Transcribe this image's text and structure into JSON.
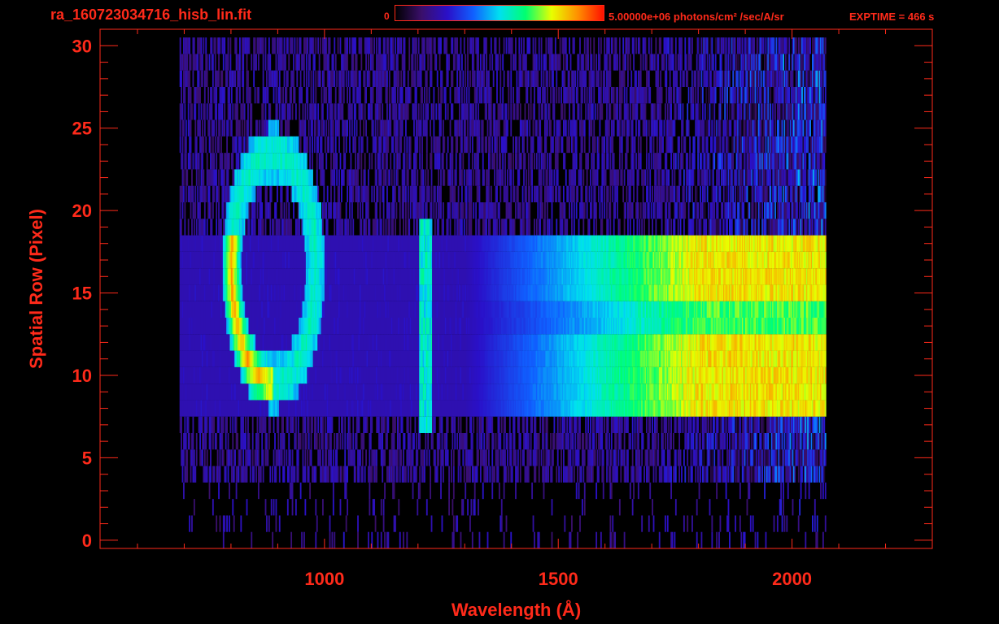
{
  "header": {
    "filename": "ra_160723034716_hisb_lin.fit",
    "colorbar_min": "0",
    "colorbar_max_label": "5.00000e+06 photons/cm² /sec/A/sr",
    "exptime": "EXPTIME = 466 s"
  },
  "colors": {
    "axis": "#ff2a1a",
    "background": "#000000"
  },
  "chart_data": {
    "type": "heatmap",
    "title": "",
    "xlabel": "Wavelength (Å)",
    "ylabel": "Spatial Row (Pixel)",
    "xlim": [
      520,
      2300
    ],
    "ylim": [
      -0.5,
      31
    ],
    "x_ticks": [
      1000,
      1500,
      2000
    ],
    "y_ticks": [
      0,
      5,
      10,
      15,
      20,
      25,
      30
    ],
    "colormap": [
      "#000000",
      "#3a0f6a",
      "#2a10c8",
      "#1060ff",
      "#00e0f0",
      "#00ff70",
      "#e8ff00",
      "#ff9000",
      "#ff1000"
    ],
    "value_range": [
      0,
      5000000
    ],
    "signal_x_range": [
      690,
      2070
    ],
    "features": [
      {
        "name": "ring",
        "x_center": 890,
        "y_center": 16.5,
        "x_radius": 90,
        "y_radius": 7
      },
      {
        "name": "line",
        "x": 1215,
        "y_range": [
          7,
          19
        ]
      },
      {
        "name": "continuum",
        "x_range": [
          1600,
          2070
        ],
        "y_range": [
          8,
          18
        ]
      }
    ]
  }
}
